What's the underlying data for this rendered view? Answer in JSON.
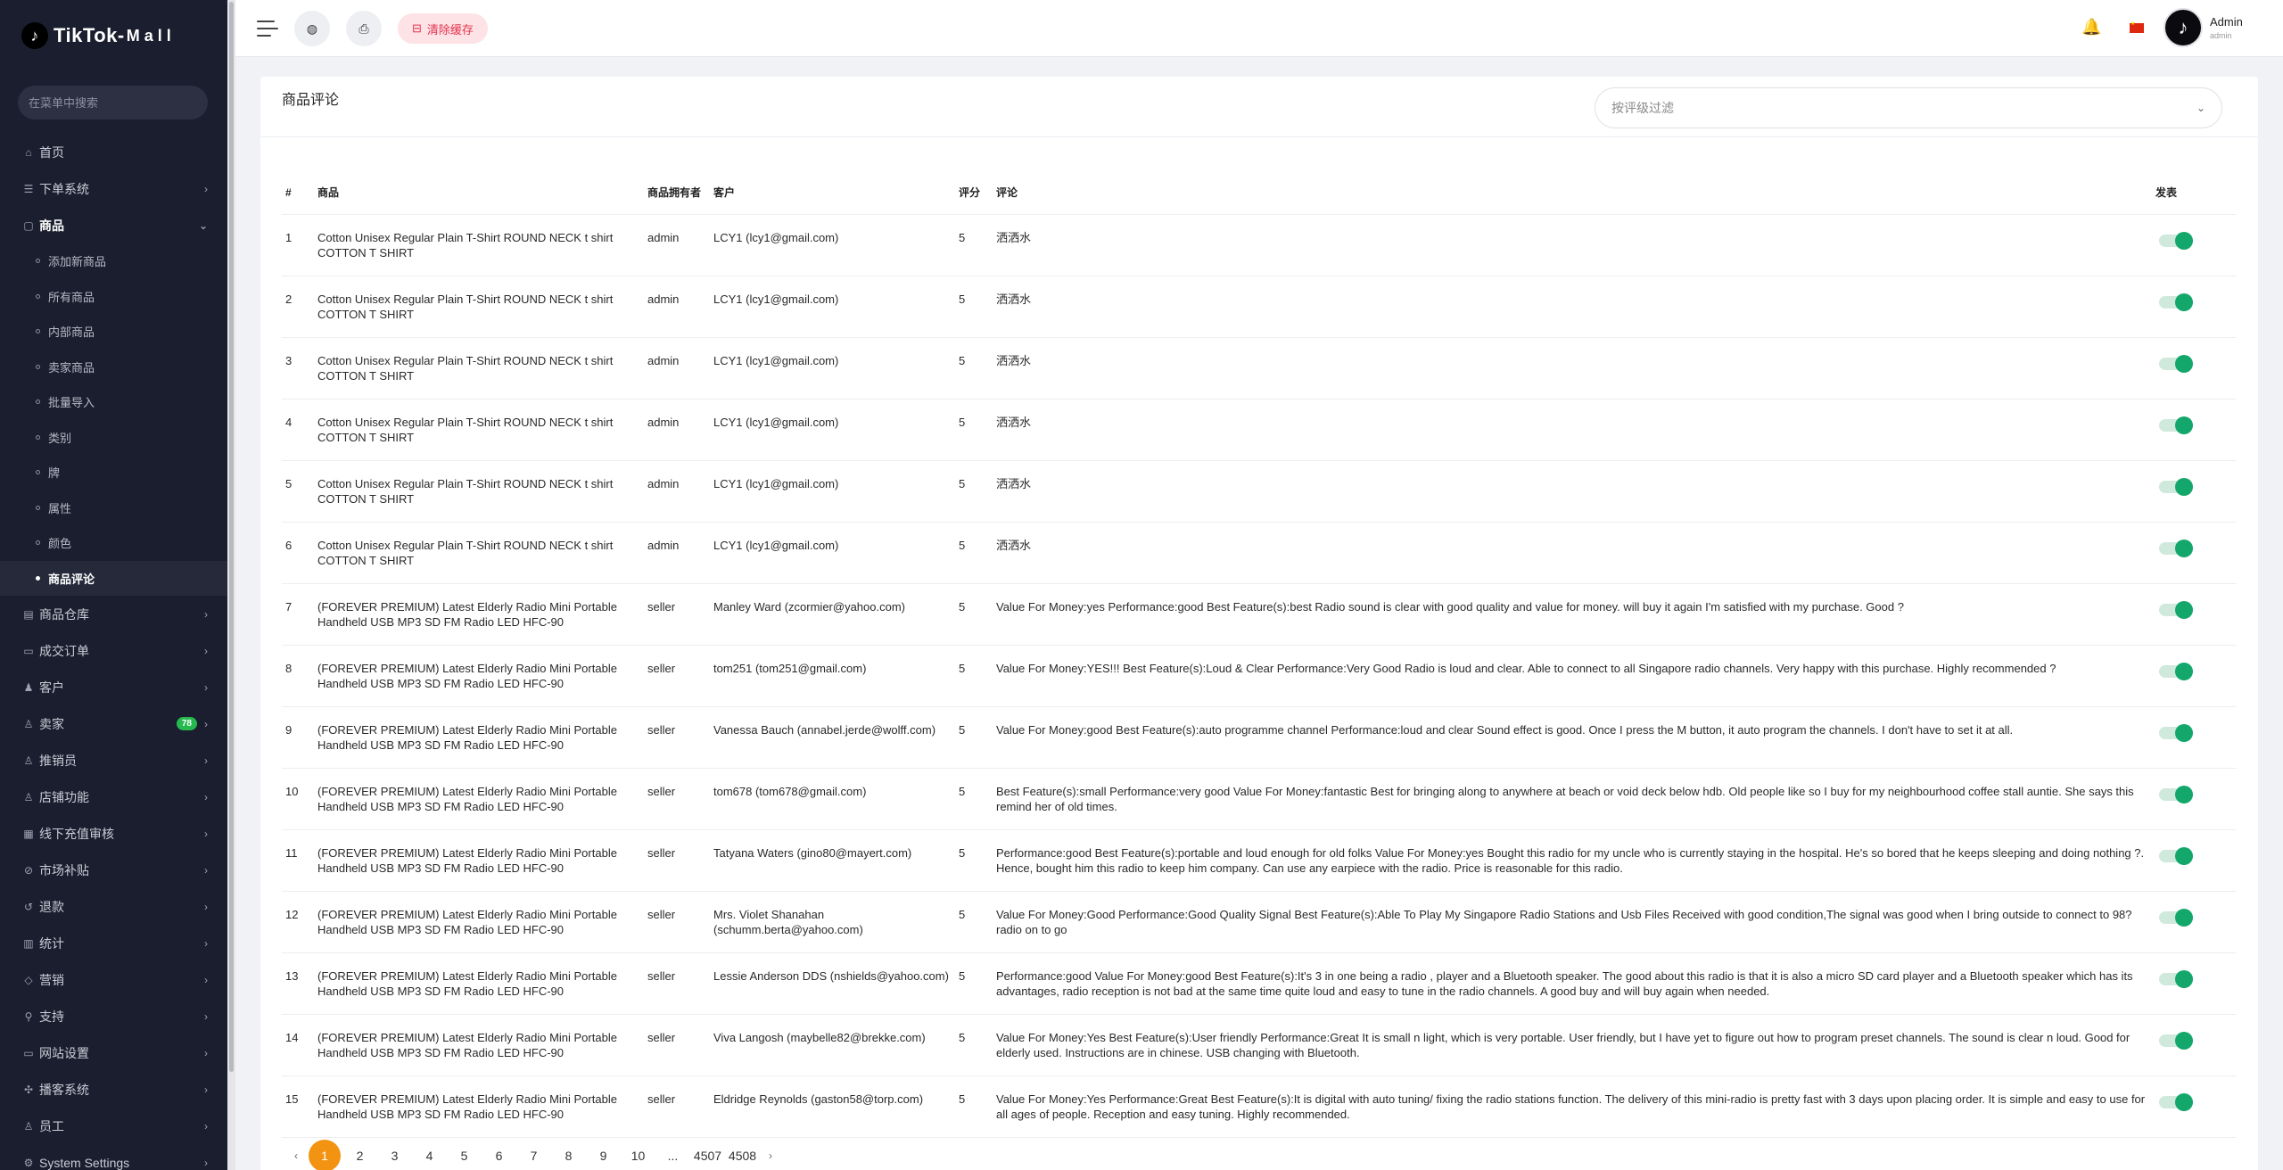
{
  "brand": {
    "name": "TikTok",
    "suffix": "Mall"
  },
  "sidebar": {
    "search_placeholder": "在菜单中搜索",
    "items": [
      {
        "label": "首页",
        "icon": "home-icon",
        "glyph": "⌂"
      },
      {
        "label": "下单系统",
        "icon": "list-icon",
        "glyph": "☰",
        "chevron": "›"
      },
      {
        "label": "商品",
        "icon": "bag-icon",
        "glyph": "▢",
        "chevron": "⌄"
      }
    ],
    "sub_items": [
      "添加新商品",
      "所有商品",
      "内部商品",
      "卖家商品",
      "批量导入",
      "类别",
      "牌",
      "属性",
      "颜色",
      "商品评论"
    ],
    "items_after": [
      {
        "label": "商品仓库",
        "icon": "warehouse-icon",
        "glyph": "▤",
        "chevron": "›"
      },
      {
        "label": "成交订单",
        "icon": "order-icon",
        "glyph": "▭",
        "chevron": "›"
      },
      {
        "label": "客户",
        "icon": "customer-icon",
        "glyph": "♟",
        "chevron": "›"
      },
      {
        "label": "卖家",
        "icon": "seller-icon",
        "glyph": "♙",
        "chevron": "›",
        "badge": "78"
      },
      {
        "label": "推销员",
        "icon": "promoter-icon",
        "glyph": "♙",
        "chevron": "›"
      },
      {
        "label": "店铺功能",
        "icon": "shop-icon",
        "glyph": "♙",
        "chevron": "›"
      },
      {
        "label": "线下充值审核",
        "icon": "recharge-icon",
        "glyph": "▦",
        "chevron": "›"
      },
      {
        "label": "市场补贴",
        "icon": "subsidy-icon",
        "glyph": "⊘",
        "chevron": "›"
      },
      {
        "label": "退款",
        "icon": "refund-icon",
        "glyph": "↺",
        "chevron": "›"
      },
      {
        "label": "统计",
        "icon": "stats-icon",
        "glyph": "▥",
        "chevron": "›"
      },
      {
        "label": "营销",
        "icon": "marketing-icon",
        "glyph": "◇",
        "chevron": "›"
      },
      {
        "label": "支持",
        "icon": "support-icon",
        "glyph": "⚲",
        "chevron": "›"
      },
      {
        "label": "网站设置",
        "icon": "website-icon",
        "glyph": "▭",
        "chevron": "›"
      },
      {
        "label": "播客系统",
        "icon": "podcast-icon",
        "glyph": "✣",
        "chevron": "›"
      },
      {
        "label": "员工",
        "icon": "staff-icon",
        "glyph": "♙",
        "chevron": "›"
      },
      {
        "label": "System Settings",
        "icon": "settings-icon",
        "glyph": "⚙",
        "chevron": "›"
      }
    ]
  },
  "header": {
    "clear_cache": "清除缓存",
    "user_name": "Admin",
    "user_role": "admin"
  },
  "page": {
    "title": "商品评论",
    "filter_placeholder": "按评级过滤"
  },
  "table": {
    "headers": {
      "num": "#",
      "product": "商品",
      "owner": "商品拥有者",
      "customer": "客户",
      "rating": "评分",
      "comment": "评论",
      "publish": "发表"
    },
    "rows": [
      {
        "num": "1",
        "product": "Cotton Unisex Regular Plain T-Shirt ROUND NECK t shirt COTTON T SHIRT",
        "owner": "admin",
        "customer": "LCY1 (lcy1@gmail.com)",
        "rating": "5",
        "comment": "洒洒水",
        "published": true
      },
      {
        "num": "2",
        "product": "Cotton Unisex Regular Plain T-Shirt ROUND NECK t shirt COTTON T SHIRT",
        "owner": "admin",
        "customer": "LCY1 (lcy1@gmail.com)",
        "rating": "5",
        "comment": "洒洒水",
        "published": true
      },
      {
        "num": "3",
        "product": "Cotton Unisex Regular Plain T-Shirt ROUND NECK t shirt COTTON T SHIRT",
        "owner": "admin",
        "customer": "LCY1 (lcy1@gmail.com)",
        "rating": "5",
        "comment": "洒洒水",
        "published": true
      },
      {
        "num": "4",
        "product": "Cotton Unisex Regular Plain T-Shirt ROUND NECK t shirt COTTON T SHIRT",
        "owner": "admin",
        "customer": "LCY1 (lcy1@gmail.com)",
        "rating": "5",
        "comment": "洒洒水",
        "published": true
      },
      {
        "num": "5",
        "product": "Cotton Unisex Regular Plain T-Shirt ROUND NECK t shirt COTTON T SHIRT",
        "owner": "admin",
        "customer": "LCY1 (lcy1@gmail.com)",
        "rating": "5",
        "comment": "洒洒水",
        "published": true
      },
      {
        "num": "6",
        "product": "Cotton Unisex Regular Plain T-Shirt ROUND NECK t shirt COTTON T SHIRT",
        "owner": "admin",
        "customer": "LCY1 (lcy1@gmail.com)",
        "rating": "5",
        "comment": "洒洒水",
        "published": true
      },
      {
        "num": "7",
        "product": "(FOREVER PREMIUM) Latest Elderly Radio Mini Portable Handheld USB MP3 SD FM Radio LED HFC-90",
        "owner": "seller",
        "customer": "Manley Ward (zcormier@yahoo.com)",
        "rating": "5",
        "comment": "Value For Money:yes Performance:good Best Feature(s):best Radio sound is clear with good quality and value for money. will buy it again I'm satisfied with my purchase. Good ?",
        "published": true
      },
      {
        "num": "8",
        "product": "(FOREVER PREMIUM) Latest Elderly Radio Mini Portable Handheld USB MP3 SD FM Radio LED HFC-90",
        "owner": "seller",
        "customer": "tom251 (tom251@gmail.com)",
        "rating": "5",
        "comment": "Value For Money:YES!!! Best Feature(s):Loud & Clear Performance:Very Good Radio is loud and clear. Able to connect to all Singapore radio channels. Very happy with this purchase. Highly recommended ?",
        "published": true
      },
      {
        "num": "9",
        "product": "(FOREVER PREMIUM) Latest Elderly Radio Mini Portable Handheld USB MP3 SD FM Radio LED HFC-90",
        "owner": "seller",
        "customer": "Vanessa Bauch (annabel.jerde@wolff.com)",
        "rating": "5",
        "comment": "Value For Money:good Best Feature(s):auto programme channel Performance:loud and clear Sound effect is good. Once I press the M button, it auto program the channels. I don't have to set it at all.",
        "published": true
      },
      {
        "num": "10",
        "product": "(FOREVER PREMIUM) Latest Elderly Radio Mini Portable Handheld USB MP3 SD FM Radio LED HFC-90",
        "owner": "seller",
        "customer": "tom678 (tom678@gmail.com)",
        "rating": "5",
        "comment": "Best Feature(s):small Performance:very good Value For Money:fantastic Best for bringing along to anywhere at beach or void deck below hdb. Old people like so I buy for my neighbourhood coffee stall auntie. She says this remind her of old times.",
        "published": true
      },
      {
        "num": "11",
        "product": "(FOREVER PREMIUM) Latest Elderly Radio Mini Portable Handheld USB MP3 SD FM Radio LED HFC-90",
        "owner": "seller",
        "customer": "Tatyana Waters (gino80@mayert.com)",
        "rating": "5",
        "comment": "Performance:good Best Feature(s):portable and loud enough for old folks Value For Money:yes Bought this radio for my uncle who is currently staying in the hospital. He's so bored that he keeps sleeping and doing nothing ?. Hence, bought him this radio to keep him company. Can use any earpiece with the radio. Price is reasonable for this radio.",
        "published": true
      },
      {
        "num": "12",
        "product": "(FOREVER PREMIUM) Latest Elderly Radio Mini Portable Handheld USB MP3 SD FM Radio LED HFC-90",
        "owner": "seller",
        "customer": "Mrs. Violet Shanahan (schumm.berta@yahoo.com)",
        "rating": "5",
        "comment": "Value For Money:Good Performance:Good Quality Signal Best Feature(s):Able To Play My Singapore Radio Stations and Usb Files Received with good condition,The signal was good when I bring outside to connect to 98? radio on to go",
        "published": true
      },
      {
        "num": "13",
        "product": "(FOREVER PREMIUM) Latest Elderly Radio Mini Portable Handheld USB MP3 SD FM Radio LED HFC-90",
        "owner": "seller",
        "customer": "Lessie Anderson DDS (nshields@yahoo.com)",
        "rating": "5",
        "comment": "Performance:good Value For Money:good Best Feature(s):It's 3 in one being a radio , player and a Bluetooth speaker. The good about this radio is that it is also a micro SD card player and a Bluetooth speaker which has its advantages, radio reception is not bad at the same time quite loud and easy to tune in the radio channels. A good buy and will buy again when needed.",
        "published": true
      },
      {
        "num": "14",
        "product": "(FOREVER PREMIUM) Latest Elderly Radio Mini Portable Handheld USB MP3 SD FM Radio LED HFC-90",
        "owner": "seller",
        "customer": "Viva Langosh (maybelle82@brekke.com)",
        "rating": "5",
        "comment": "Value For Money:Yes Best Feature(s):User friendly Performance:Great It is small n light, which is very portable. User friendly, but I have yet to figure out how to program preset channels. The sound is clear n loud. Good for elderly used. Instructions are in chinese. USB changing with Bluetooth.",
        "published": true
      },
      {
        "num": "15",
        "product": "(FOREVER PREMIUM) Latest Elderly Radio Mini Portable Handheld USB MP3 SD FM Radio LED HFC-90",
        "owner": "seller",
        "customer": "Eldridge Reynolds (gaston58@torp.com)",
        "rating": "5",
        "comment": "Value For Money:Yes Performance:Great Best Feature(s):It is digital with auto tuning/ fixing the radio stations function. The delivery of this mini-radio is pretty fast with 3 days upon placing order. It is simple and easy to use for all ages of people. Reception and easy tuning. Highly recommended.",
        "published": true
      }
    ]
  },
  "pagination": {
    "prev": "‹",
    "next": "›",
    "pages": [
      "1",
      "2",
      "3",
      "4",
      "5",
      "6",
      "7",
      "8",
      "9",
      "10",
      "...",
      "4507",
      "4508"
    ],
    "current": "1"
  },
  "colors": {
    "sidebar_bg": "#1b1e2e",
    "accent": "#f39312",
    "toggle_on": "#14a76c",
    "badge": "#25b94f",
    "cache_btn_text": "#e3344e"
  }
}
